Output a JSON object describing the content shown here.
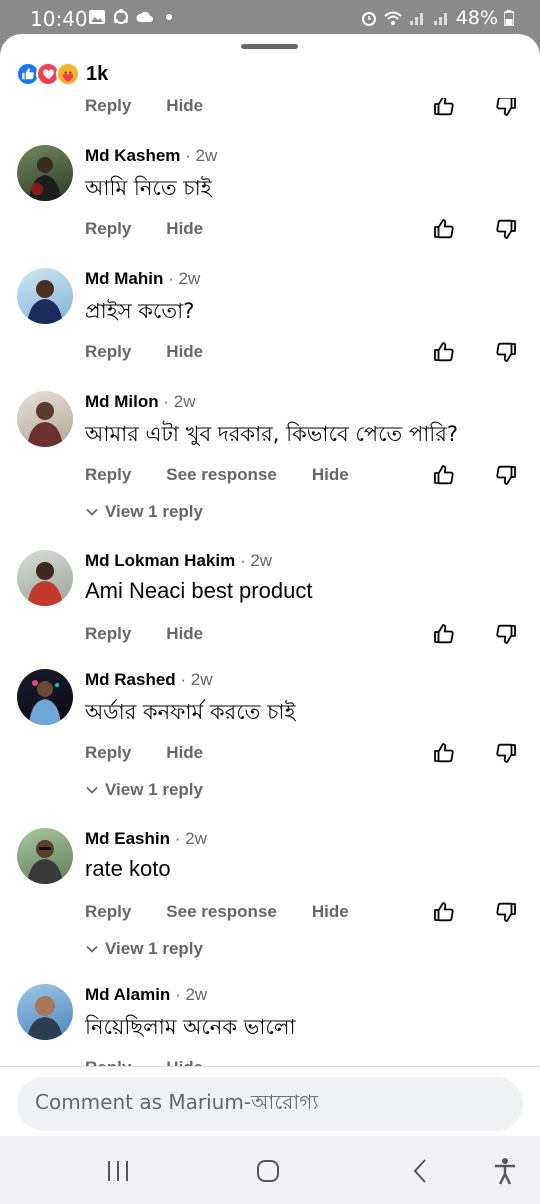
{
  "status_bar": {
    "time": "10:40",
    "battery": "48%"
  },
  "reactions": {
    "count": "1k",
    "types": [
      "like-icon",
      "love-icon",
      "care-icon"
    ]
  },
  "partial_top": {
    "reply": "Reply",
    "hide": "Hide"
  },
  "comments": [
    {
      "name": "Md Kashem",
      "time": "· 2w",
      "text": "আমি নিতে চাই",
      "actions": [
        "Reply",
        "Hide"
      ]
    },
    {
      "name": "Md Mahin",
      "time": "· 2w",
      "text": "প্রাইস কতো?",
      "actions": [
        "Reply",
        "Hide"
      ]
    },
    {
      "name": "Md Milon",
      "time": "· 2w",
      "text": "আমার এটা খুব দরকার, কিভাবে পেতে পারি?",
      "actions": [
        "Reply",
        "See response",
        "Hide"
      ],
      "view_reply": "View 1 reply"
    },
    {
      "name": "Md Lokman Hakim",
      "time": "· 2w",
      "text": "Ami Neaci best product",
      "actions": [
        "Reply",
        "Hide"
      ]
    },
    {
      "name": "Md Rashed",
      "time": "· 2w",
      "text": "অর্ডার কনফার্ম করতে চাই",
      "actions": [
        "Reply",
        "Hide"
      ],
      "view_reply": "View 1 reply"
    },
    {
      "name": "Md Eashin",
      "time": "· 2w",
      "text": "rate koto",
      "actions": [
        "Reply",
        "See response",
        "Hide"
      ],
      "view_reply": "View 1 reply"
    },
    {
      "name": "Md Alamin",
      "time": "· 2w",
      "text": "নিয়েছিলাম অনেক ভালো",
      "actions": [
        "Reply",
        "Hide"
      ]
    }
  ],
  "composer": {
    "placeholder": "Comment as Marium-আরোগ্য"
  },
  "colors": {
    "accent": "#1877f2",
    "love": "#f33e58",
    "care": "#f7b125",
    "secondary_text": "#65676b",
    "input_bg": "#f0f2f5"
  }
}
